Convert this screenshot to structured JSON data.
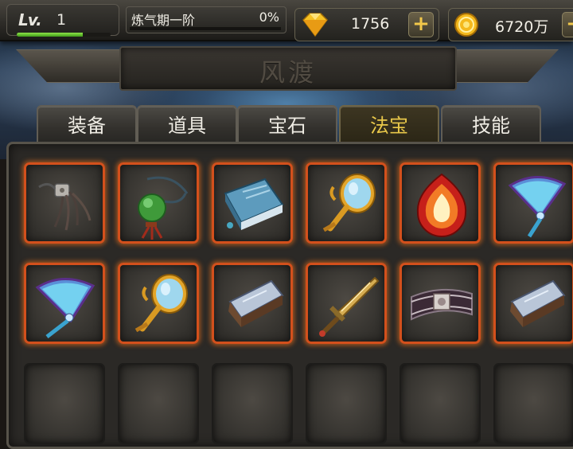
{
  "hud": {
    "level_label": "Lv.",
    "level_value": "1",
    "realm_name": "炼气期一阶",
    "realm_progress": "0%",
    "gems": "1756",
    "gold": "6720万",
    "plus_symbol": "+"
  },
  "title": "风渡",
  "tabs": [
    {
      "label": "装备"
    },
    {
      "label": "道具"
    },
    {
      "label": "宝石"
    },
    {
      "label": "法宝",
      "active": true
    },
    {
      "label": "技能"
    }
  ],
  "slots": [
    {
      "item": "tassel-ornament-icon"
    },
    {
      "item": "jade-pendant-icon"
    },
    {
      "item": "blue-book-icon"
    },
    {
      "item": "golden-mirror-icon"
    },
    {
      "item": "flame-emblem-icon"
    },
    {
      "item": "feather-fan-icon"
    },
    {
      "item": "feather-fan-icon"
    },
    {
      "item": "golden-mirror-icon"
    },
    {
      "item": "stone-scroll-icon"
    },
    {
      "item": "golden-sword-icon"
    },
    {
      "item": "ornate-belt-icon"
    },
    {
      "item": "stone-scroll-icon"
    },
    {
      "item": null
    },
    {
      "item": null
    },
    {
      "item": null
    },
    {
      "item": null
    },
    {
      "item": null
    },
    {
      "item": null
    }
  ],
  "colors": {
    "slot_border": "#d3501c",
    "active_tab_text": "#e9c84a",
    "exp_bar": "#5fc72a"
  }
}
